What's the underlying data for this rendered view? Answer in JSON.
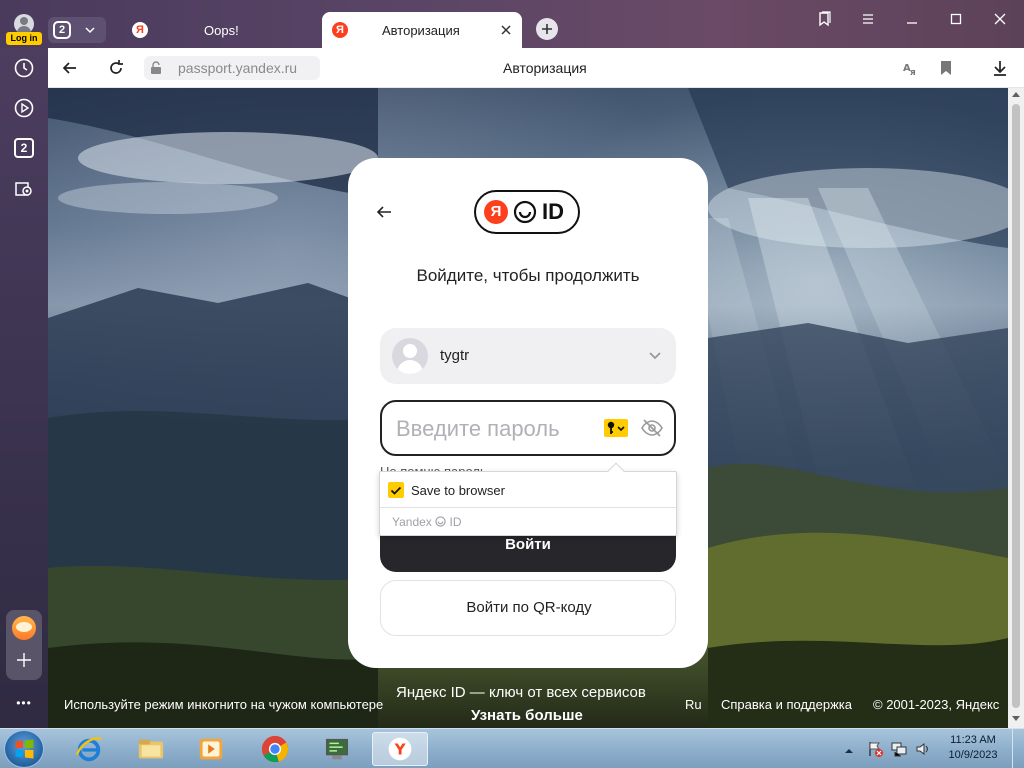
{
  "browser": {
    "login_badge": "Log in",
    "tab_group_count": "2",
    "tabs": [
      {
        "label": "Oops!"
      },
      {
        "label": "Авторизация"
      }
    ],
    "address": {
      "url": "passport.yandex.ru",
      "page_title": "Авторизация"
    },
    "sidebar": {
      "tab_count": "2",
      "more": "•••"
    }
  },
  "auth": {
    "logo_text": "ID",
    "heading": "Войдите, чтобы продолжить",
    "account_name": "tygtr",
    "password_placeholder": "Введите пароль",
    "hidden_link": "Не помню пароль",
    "submit_label": "Войти",
    "qr_label": "Войти по QR-коду",
    "popup": {
      "save_label": "Save to browser",
      "brand_left": "Yandex",
      "brand_right": "ID",
      "checked": true
    }
  },
  "footer": {
    "incognito_hint": "Используйте режим инкогнито на чужом компьютере",
    "tagline": "Яндекс ID — ключ от всех сервисов",
    "learn_more": "Узнать больше",
    "lang": "Ru",
    "help": "Справка и поддержка",
    "copyright": "© 2001-2023, Яндекс"
  },
  "taskbar": {
    "time": "11:23 AM",
    "date": "10/9/2023"
  },
  "colors": {
    "accent_yellow": "#ffcc00",
    "yandex_red": "#fc3f1d",
    "dark_button": "#26262b"
  }
}
